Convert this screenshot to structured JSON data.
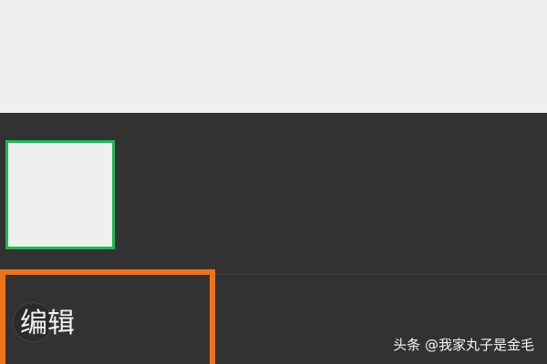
{
  "colors": {
    "top_background": "#efefef",
    "panel_background": "#323232",
    "thumbnail_border": "#1db954",
    "highlight_border": "#f07318",
    "text": "#f2f2f2"
  },
  "edit_button": {
    "label": "编辑"
  },
  "watermark": {
    "text": "头条 @我家丸子是金毛"
  }
}
